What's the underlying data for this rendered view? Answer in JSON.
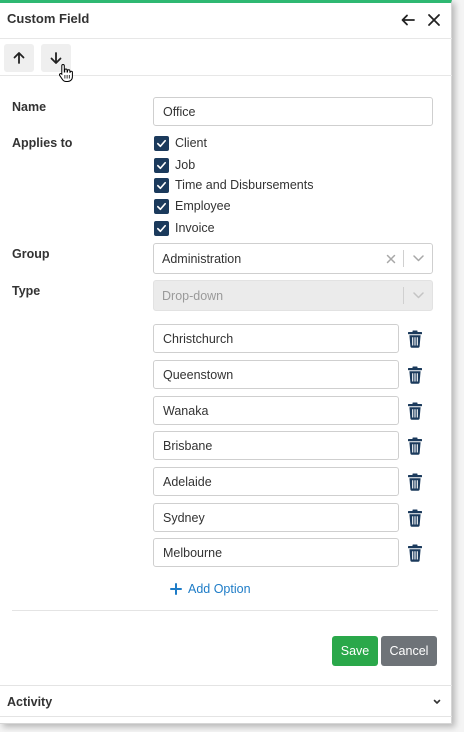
{
  "header": {
    "title": "Custom Field"
  },
  "colors": {
    "accent": "#2eb872",
    "checkbox": "#1b3a5c",
    "link": "#1e7cc7",
    "save": "#2aa84a",
    "cancel": "#6e7378"
  },
  "form": {
    "name": {
      "label": "Name",
      "value": "Office"
    },
    "applies_to": {
      "label": "Applies to",
      "options": [
        {
          "label": "Client",
          "checked": true
        },
        {
          "label": "Job",
          "checked": true
        },
        {
          "label": "Time and Disbursements",
          "checked": true
        },
        {
          "label": "Employee",
          "checked": true
        },
        {
          "label": "Invoice",
          "checked": true
        }
      ]
    },
    "group": {
      "label": "Group",
      "value": "Administration"
    },
    "type": {
      "label": "Type",
      "value": "Drop-down"
    },
    "options": [
      "Christchurch",
      "Queenstown",
      "Wanaka",
      "Brisbane",
      "Adelaide",
      "Sydney",
      "Melbourne"
    ],
    "add_option_label": "Add Option"
  },
  "actions": {
    "save_label": "Save",
    "cancel_label": "Cancel"
  },
  "activity": {
    "label": "Activity"
  }
}
